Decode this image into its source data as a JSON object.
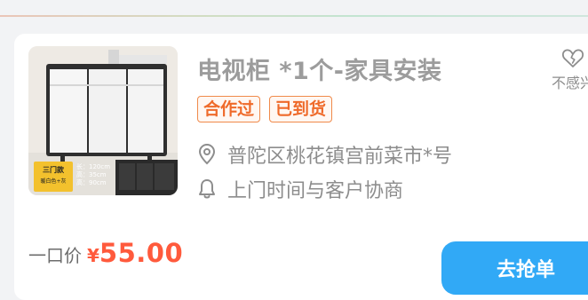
{
  "order": {
    "title": "电视柜 *1个-家具安装",
    "tags": [
      "合作过",
      "已到货"
    ],
    "address": "普陀区桃花镇宫前菜市*号",
    "service_time": "上门时间与客户协商",
    "dislike_label": "不感兴",
    "price_label": "一口价",
    "price_symbol": "¥",
    "price_value": "55.00",
    "grab_button": "去抢单"
  },
  "thumbnail": {
    "badge": "三门款",
    "badge_sub": "暖白色+灰",
    "specs": [
      "长：120cm",
      "高：35cm",
      "高：90cm"
    ]
  },
  "colors": {
    "accent": "#31a9f6",
    "price": "#ff5a3c",
    "tag": "#ef6a2a",
    "muted": "#8d8d8d"
  },
  "icons": [
    "location-pin-icon",
    "bell-icon",
    "broken-heart-icon"
  ]
}
